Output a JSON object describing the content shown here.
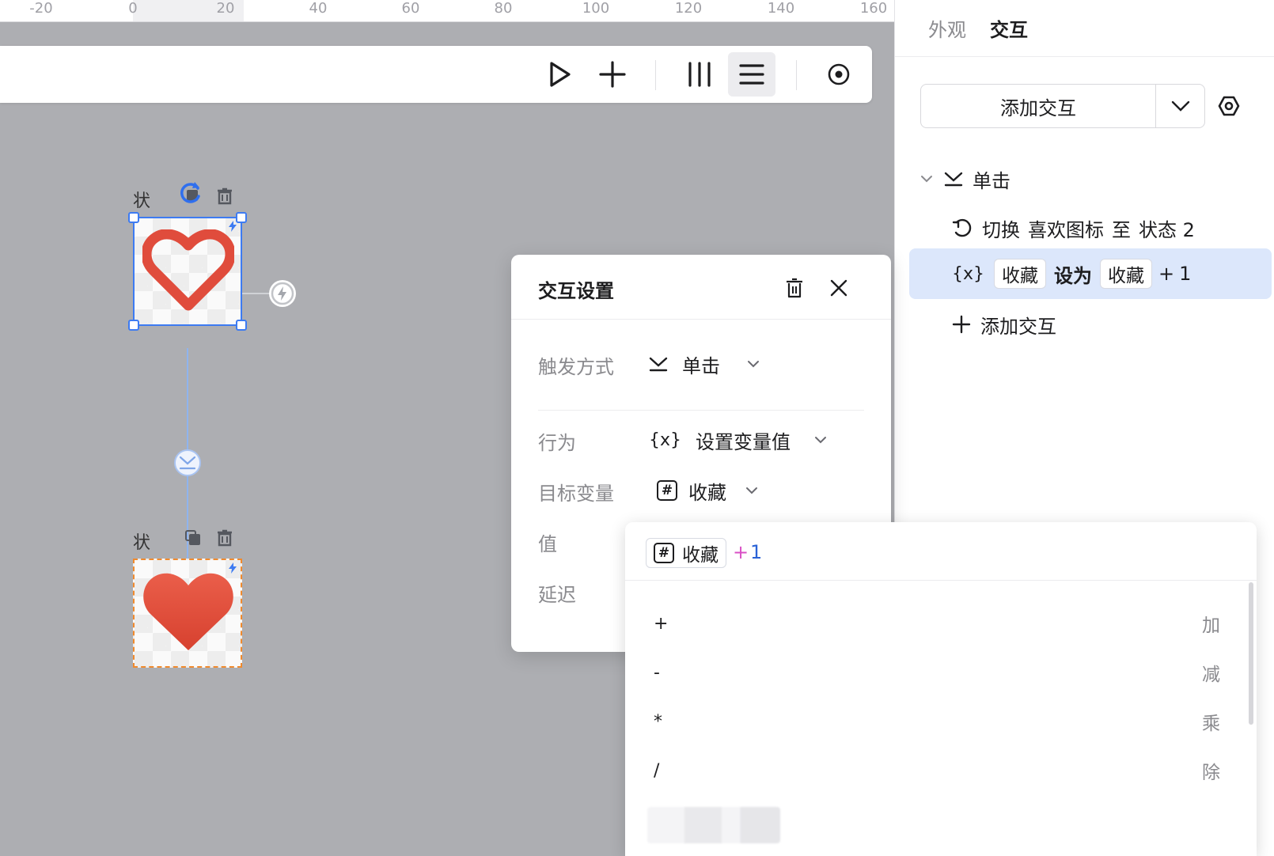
{
  "ruler": {
    "ticks": [
      "-20",
      "0",
      "20",
      "40",
      "60",
      "80",
      "100",
      "120",
      "140",
      "160"
    ]
  },
  "toolbar": {
    "buttons": [
      "play-icon",
      "plus-icon",
      "column-layout-icon",
      "row-layout-icon",
      "record-icon"
    ],
    "active": "row-layout-icon"
  },
  "canvas": {
    "state1": {
      "label": "状",
      "selected": true
    },
    "state2": {
      "label": "状",
      "selected": false
    }
  },
  "panel": {
    "tabs": {
      "appearance": "外观",
      "interaction": "交互"
    },
    "add_interaction": "添加交互",
    "trigger": "单击",
    "action1": {
      "verb": "切换",
      "target": "喜欢图标",
      "to": "至",
      "state": "状态 2"
    },
    "action2": {
      "icon_text": "{x}",
      "var": "收藏",
      "set": "设为",
      "value_var": "收藏",
      "plus": "+",
      "num": "1"
    },
    "add_interaction_row": "添加交互"
  },
  "dialog": {
    "title": "交互设置",
    "trigger_label": "触发方式",
    "trigger_value": "单击",
    "action_label": "行为",
    "action_icon_text": "{x}",
    "action_value": "设置变量值",
    "target_label": "目标变量",
    "target_icon_text": "#",
    "target_value": "收藏",
    "value_label": "值",
    "delay_label": "延迟"
  },
  "dropdown": {
    "expr": {
      "icon_text": "#",
      "var": "收藏",
      "op": "+",
      "num": "1"
    },
    "items": [
      {
        "symbol": "+",
        "desc": "加"
      },
      {
        "symbol": "-",
        "desc": "减"
      },
      {
        "symbol": "*",
        "desc": "乘"
      },
      {
        "symbol": "/",
        "desc": "除"
      }
    ]
  },
  "colors": {
    "accent": "#3d7bf2",
    "heart": "#e04c3c",
    "selection_bg": "#dce7fb",
    "operator_plus": "#d94fc5",
    "operator_num": "#2a62d6"
  }
}
